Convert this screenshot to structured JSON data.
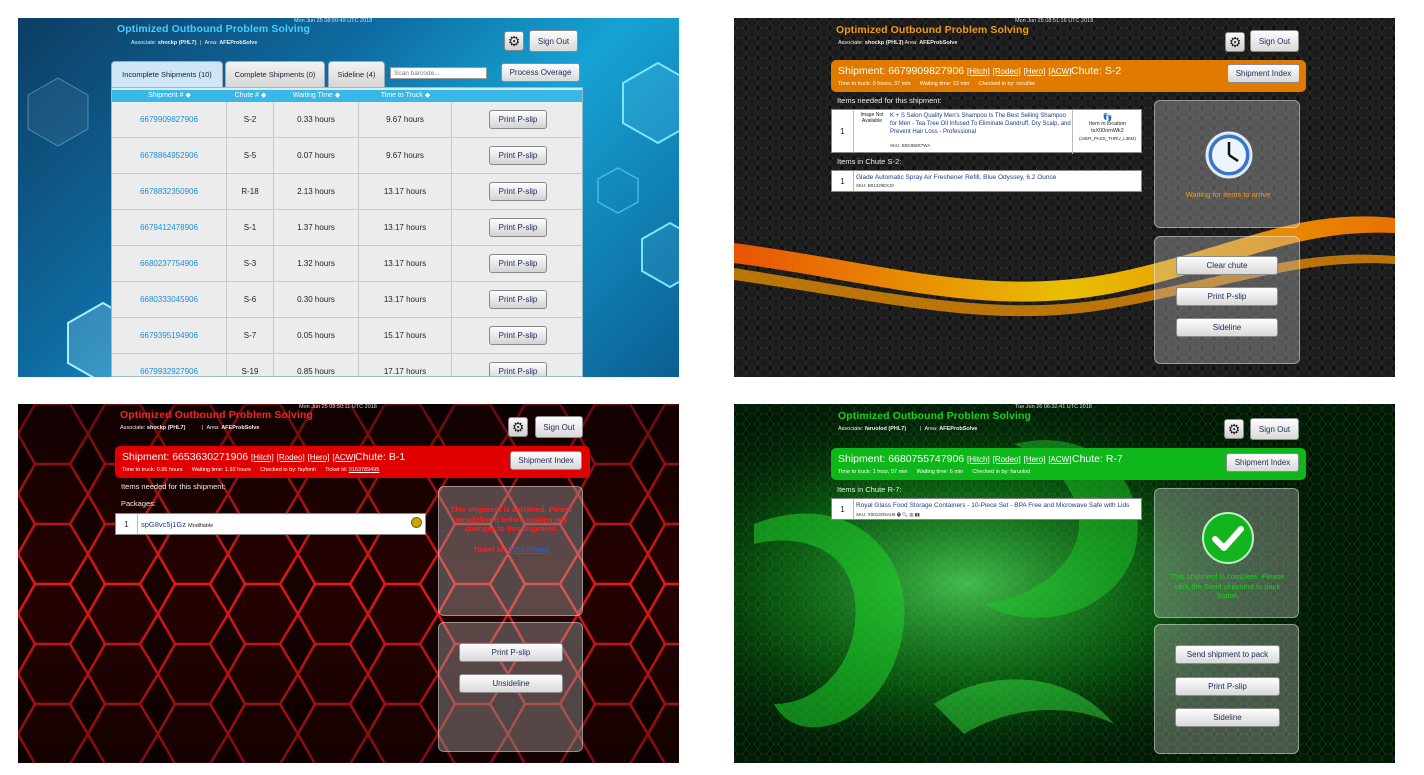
{
  "panel1": {
    "app_title": "Optimized Outbound Problem Solving",
    "date": "Mon Jun 25 08:50:49 UTC 2018",
    "associate_label": "Associate:",
    "associate": "shockp (PHL7)",
    "area_label": "Area:",
    "area": "AFEProbSolve",
    "sign_out": "Sign Out",
    "gear_icon": "gear-icon",
    "tabs": [
      "Incomplete Shipments (10)",
      "Complete Shipments (0)",
      "Sideline (4)"
    ],
    "scan_placeholder": "Scan barcode...",
    "process_overage": "Process Overage",
    "columns": [
      "Shipment #",
      "Chute #",
      "Waiting Time",
      "Time to Truck"
    ],
    "sort_icon": "sort-arrow-icon",
    "print_label": "Print P-slip",
    "rows": [
      {
        "shipment": "6679909827906",
        "chute": "S-2",
        "waiting": "0.33 hours",
        "truck": "9.67 hours"
      },
      {
        "shipment": "6678864952906",
        "chute": "S-5",
        "waiting": "0.07 hours",
        "truck": "9.67 hours"
      },
      {
        "shipment": "6678832350906",
        "chute": "R-18",
        "waiting": "2.13 hours",
        "truck": "13.17 hours"
      },
      {
        "shipment": "6679412478906",
        "chute": "S-1",
        "waiting": "1.37 hours",
        "truck": "13.17 hours"
      },
      {
        "shipment": "6680237754906",
        "chute": "S-3",
        "waiting": "1.32 hours",
        "truck": "13.17 hours"
      },
      {
        "shipment": "6680333045906",
        "chute": "S-6",
        "waiting": "0.30 hours",
        "truck": "13.17 hours"
      },
      {
        "shipment": "6679395194906",
        "chute": "S-7",
        "waiting": "0.05 hours",
        "truck": "15.17 hours"
      },
      {
        "shipment": "6679932927906",
        "chute": "S-19",
        "waiting": "0.85 hours",
        "truck": "17.17 hours"
      }
    ]
  },
  "panel2": {
    "app_title": "Optimized Outbound Problem Solving",
    "date": "Mon Jun 25 08:51:16 UTC 2018",
    "associate_label": "Associate:",
    "associate": "shockp (PHL7)",
    "area_label": "Area:",
    "area": "AFEProbSolve",
    "sign_out": "Sign Out",
    "shipment_label": "Shipment:",
    "shipment": "6679909827906",
    "links": [
      "[Hitch]",
      "[Rodeo]",
      "[Hero]",
      "[ACW]"
    ],
    "chute": "Chute: S-2",
    "time_to_truck": "Time to truck: 9 hours, 37 min",
    "waiting_time": "Waiting time: 22 min",
    "checked_in": "Checked in by: roculliw",
    "shipment_index": "Shipment Index",
    "needed_head": "Items needed for this shipment:",
    "needed_item": {
      "qty": "1",
      "image_na": "Image Not Available",
      "title": "K + S Salon Quality Men's Shampoo Is The Best Selling Shampoo for Men - Tea Tree Oil Infused To Eliminate Dandruff, Dry Scalp, and Prevent Hair Loss - Professional",
      "sku": "SKU: B00JB6R7WA",
      "location_label": "Item in location",
      "location": "tsX00nmWk2",
      "location_code": "(cvER_PASS_THRU_L3M2)"
    },
    "chute_head": "Items in Chute S-2:",
    "chute_item": {
      "qty": "1",
      "title": "Glade Automatic Spray Air Freshener Refill, Blue Odyssey, 6.2 Ounce",
      "sku": "SKU: B013J9EXJ0"
    },
    "status": "Waiting for items to arrive",
    "status_icon": "clock-icon",
    "buttons": [
      "Clear chute",
      "Print P-slip",
      "Sideline"
    ]
  },
  "panel3": {
    "app_title": "Optimized Outbound Problem Solving",
    "date": "Mon Jun 25 08:50:11 UTC 2018",
    "associate_label": "Associate:",
    "associate": "shockp (PHL7)",
    "area_label": "Area:",
    "area": "AFEProbSolve",
    "sign_out": "Sign Out",
    "shipment_label": "Shipment:",
    "shipment": "6653630271906",
    "links": [
      "[Hitch]",
      "[Rodeo]",
      "[Hero]",
      "[ACW]"
    ],
    "chute": "Chute: B-1",
    "time_to_truck": "Time to truck: 0.95 hours",
    "waiting_time": "Waiting time: 1.92 hours",
    "checked_in": "Checked in by: fayfonh",
    "ticket_label": "Ticket Id:",
    "ticket": "0153789495",
    "shipment_index": "Shipment Index",
    "needed_head": "Items needed for this shipment:",
    "packages_head": "Packages:",
    "package": {
      "qty": "1",
      "code": "spG8vc5j1Gz",
      "note": "Modifiable"
    },
    "status": "This shipment is sidelined. Please unsideline it before making any changes to this shipment.",
    "status_ticket_label": "Ticket Id:",
    "status_ticket": "0153789495",
    "buttons": [
      "Print P-slip",
      "Unsideline"
    ]
  },
  "panel4": {
    "app_title": "Optimized Outbound Problem Solving",
    "date": "Tue Jun 26 06:32:41 UTC 2018",
    "associate_label": "Associate:",
    "associate": "faruolod (PHL7)",
    "area_label": "Area:",
    "area": "AFEProbSolve",
    "sign_out": "Sign Out",
    "shipment_label": "Shipment:",
    "shipment": "6680755747906",
    "links": [
      "[Hitch]",
      "[Rodeo]",
      "[Hero]",
      "[ACW]"
    ],
    "chute": "Chute: R-7",
    "time_to_truck": "Time to truck: 1 hour, 57 min",
    "waiting_time": "Waiting time: 6 min",
    "checked_in": "Checked in by: faruolod",
    "shipment_index": "Shipment Index",
    "chute_head": "Items in Chute R-7:",
    "chute_item": {
      "qty": "1",
      "title": "Royal Glass Food Storage Containers - 10-Piece Set - BPA Free and Microwave Safe with Lids",
      "sku": "SKU: X0013O5AH6"
    },
    "status": "This shipment is complete. Please click the Send shipment to pack button",
    "status_icon": "checkmark-icon",
    "buttons": [
      "Send shipment to pack",
      "Print P-slip",
      "Sideline"
    ]
  },
  "colors": {
    "blue_header": "#39b7e6",
    "orange_bar": "#e07b00",
    "red_bar": "#e00000",
    "green_bar": "#0fb81a",
    "red_text": "#ff2020",
    "green_text": "#19d219",
    "orange_text": "#f29a1c"
  }
}
